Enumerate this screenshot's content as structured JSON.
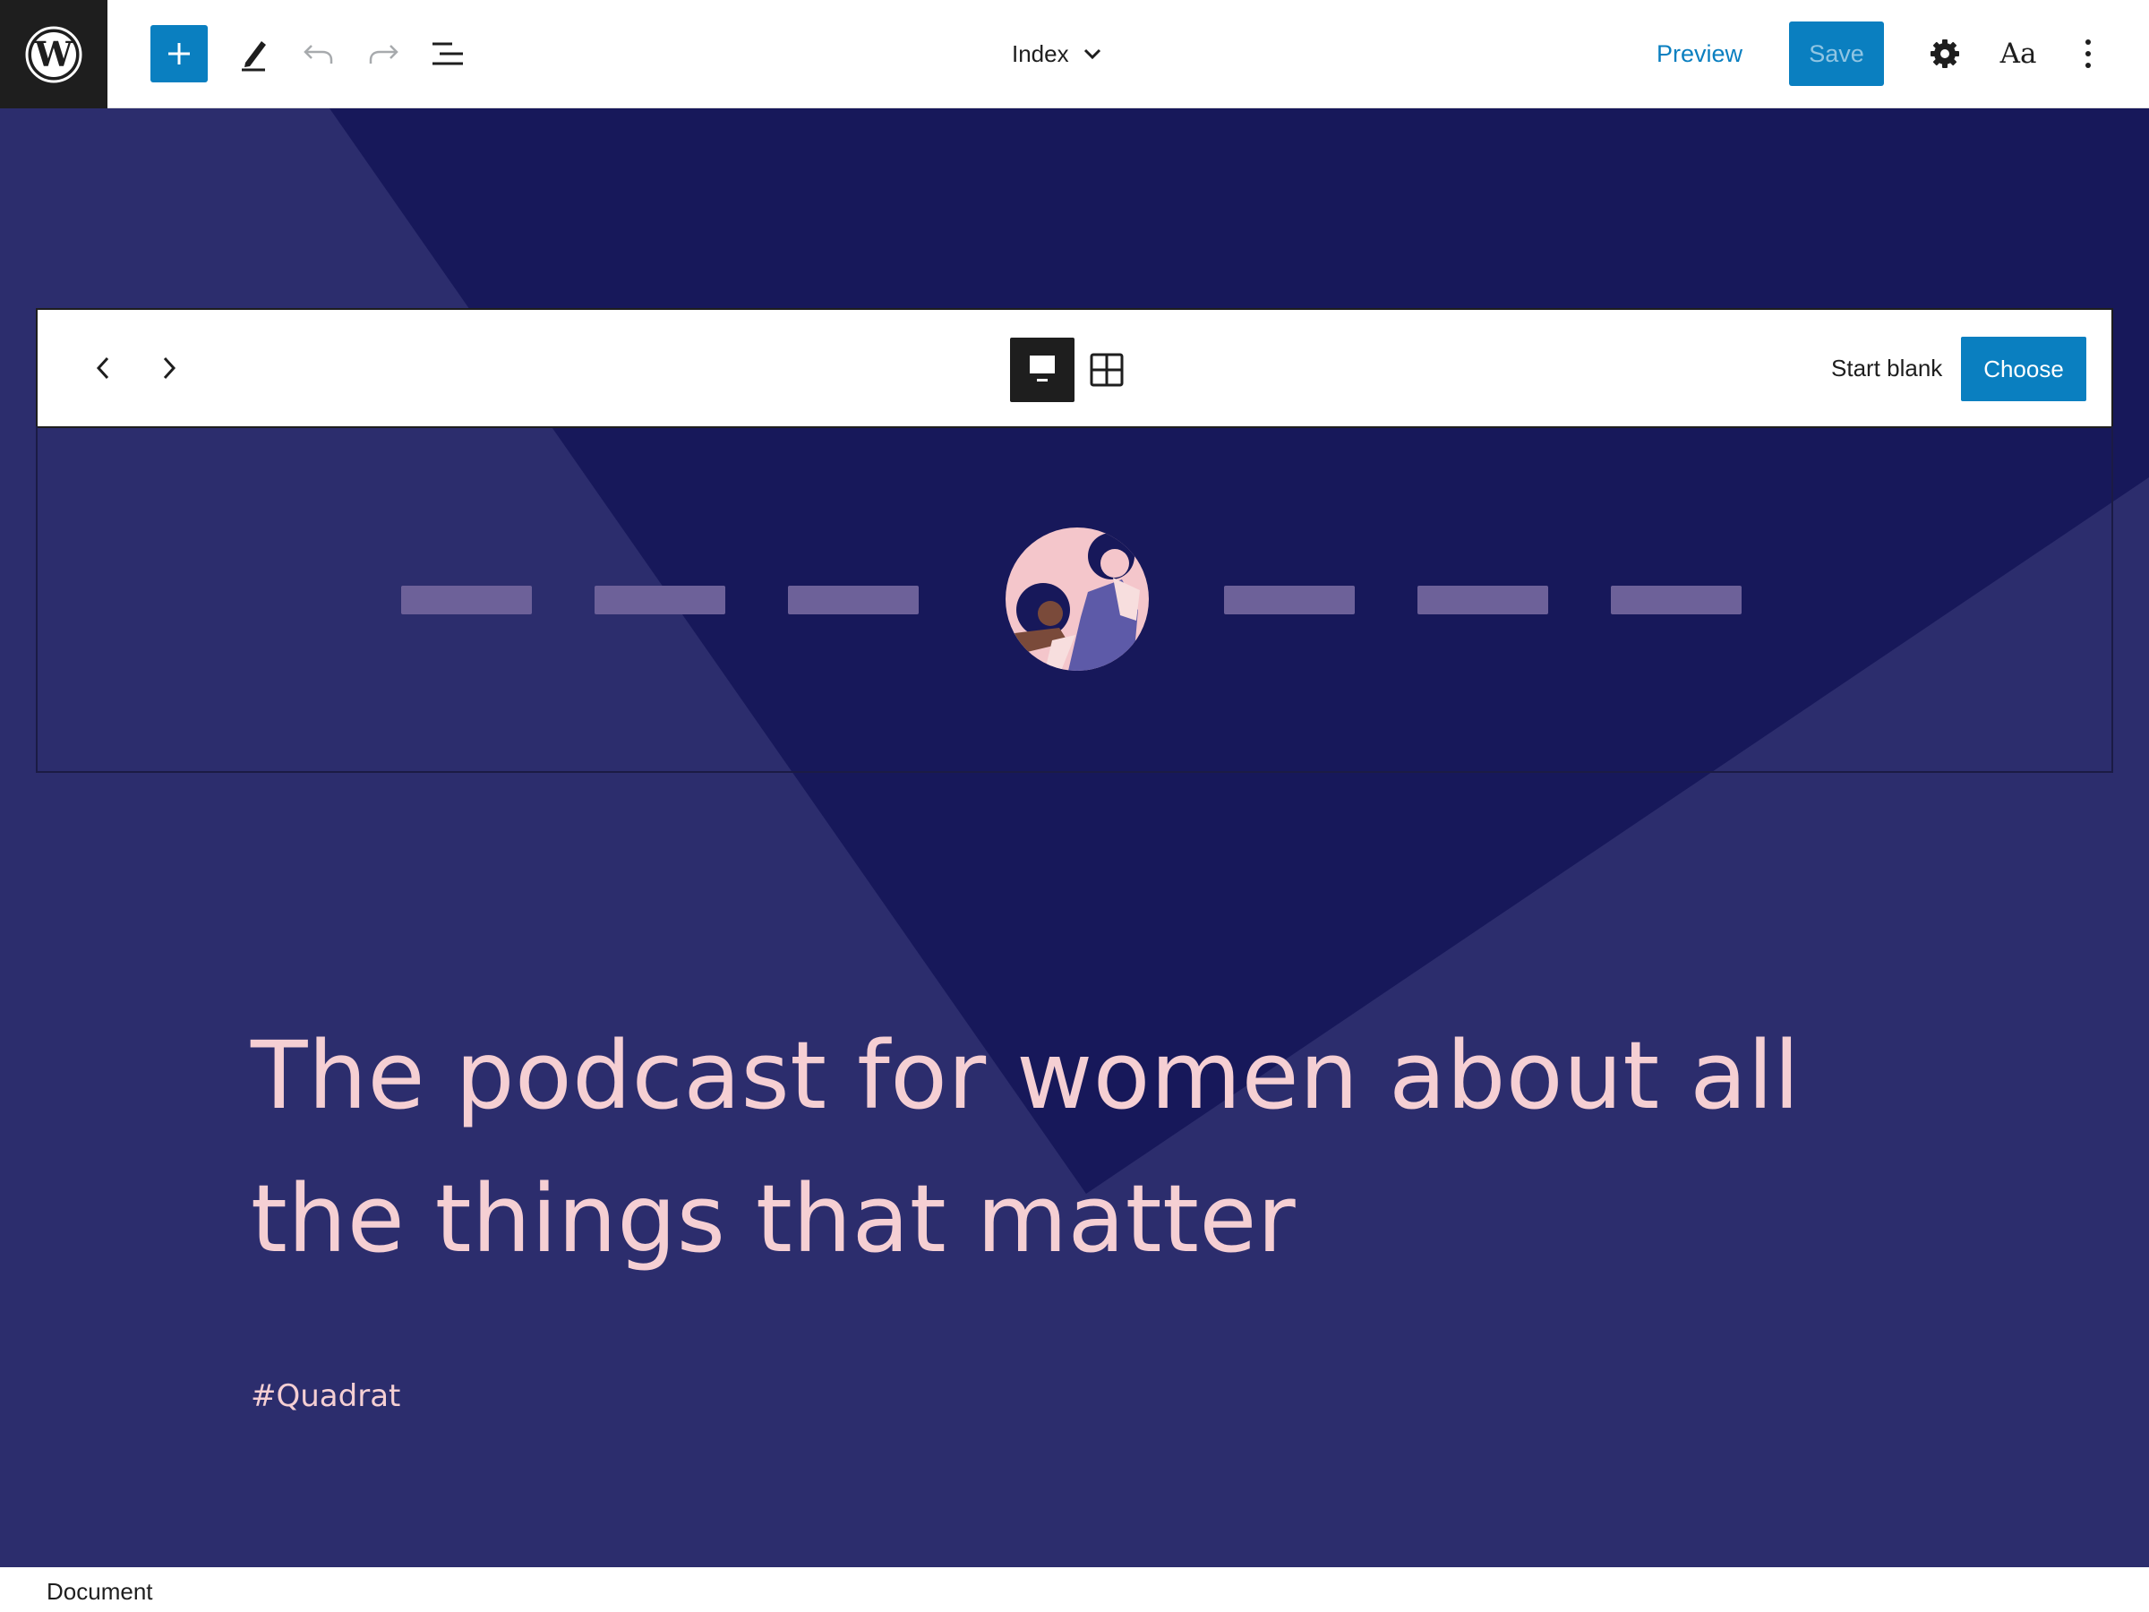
{
  "topbar": {
    "logo_icon": "wordpress-logo-icon",
    "add_block_icon": "plus-icon",
    "tools_icon": "pencil-icon",
    "undo_icon": "undo-icon",
    "redo_icon": "redo-icon",
    "list_view_icon": "list-view-icon",
    "document_title": "Index",
    "preview_label": "Preview",
    "save_label": "Save",
    "settings_icon": "gear-icon",
    "styles_label": "Aa",
    "options_icon": "more-vertical-icon"
  },
  "pattern_selector": {
    "prev_icon": "chevron-left-icon",
    "next_icon": "chevron-right-icon",
    "carousel_view_icon": "single-view-icon",
    "grid_view_icon": "grid-view-icon",
    "start_blank_label": "Start blank",
    "choose_label": "Choose",
    "preview_nav_item_count": 6
  },
  "canvas": {
    "headline": "The podcast for women about all the things that matter",
    "hashtag": "#Quadrat"
  },
  "footer": {
    "breadcrumb": "Document"
  },
  "colors": {
    "accent": "#0a7fc0",
    "canvas_background": "#2c2d6d",
    "canvas_shape": "#17185a",
    "headline_text": "#f5cfd3",
    "nav_placeholder": "#6d6199"
  }
}
